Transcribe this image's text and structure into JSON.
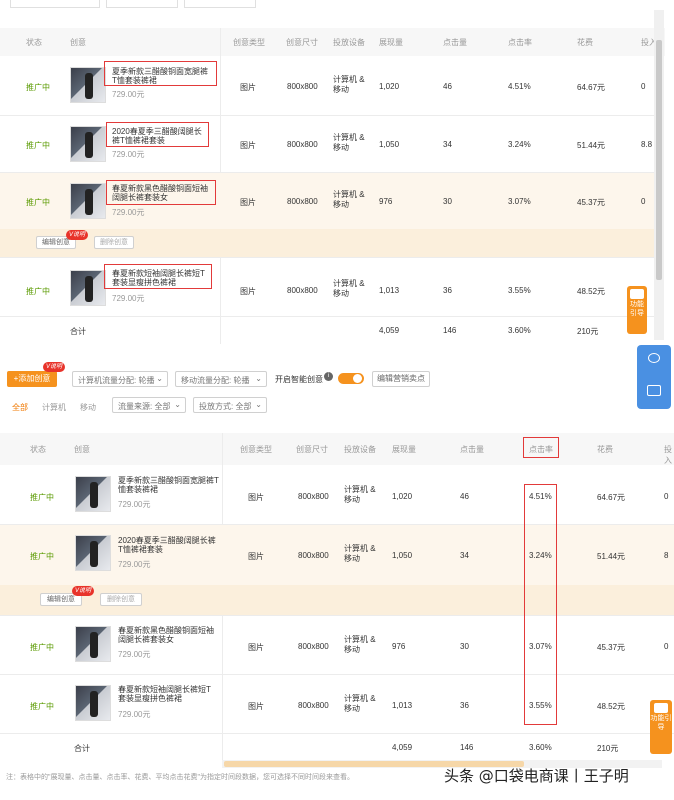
{
  "table_headers": {
    "status": "状态",
    "creative": "创意",
    "type": "创意类型",
    "size": "创意尺寸",
    "device": "投放设备",
    "impressions": "展现量",
    "clicks": "点击量",
    "ctr": "点击率",
    "cost": "花费",
    "extra": "投入"
  },
  "top_rows": [
    {
      "status": "推广中",
      "title": "夏季新款三醋酸铜面宽腿裤T恤套装裤裙",
      "price": "729.00元",
      "type": "图片",
      "size": "800x800",
      "device": "计算机 & 移动",
      "impressions": "1,020",
      "clicks": "46",
      "ctr": "4.51%",
      "cost": "64.67元",
      "extra": "0"
    },
    {
      "status": "推广中",
      "title": "2020春夏季三醋酸阔腿长裤T恤裤裙套装",
      "price": "729.00元",
      "type": "图片",
      "size": "800x800",
      "device": "计算机 & 移动",
      "impressions": "1,050",
      "clicks": "34",
      "ctr": "3.24%",
      "cost": "51.44元",
      "extra": "8.8"
    },
    {
      "status": "推广中",
      "title": "春夏新款黑色醋酸铜面短袖阔腿长裤套装女",
      "price": "729.00元",
      "type": "图片",
      "size": "800x800",
      "device": "计算机 & 移动",
      "impressions": "976",
      "clicks": "30",
      "ctr": "3.07%",
      "cost": "45.37元",
      "extra": "0"
    },
    {
      "status": "推广中",
      "title": "春夏新款短袖阔腿长裤短T套装显瘦拼色裤裙",
      "price": "729.00元",
      "type": "图片",
      "size": "800x800",
      "device": "计算机 & 移动",
      "impressions": "1,013",
      "clicks": "36",
      "ctr": "3.55%",
      "cost": "48.52元",
      "extra": "0"
    }
  ],
  "top_total": {
    "label": "合计",
    "impressions": "4,059",
    "clicks": "146",
    "ctr": "3.60%",
    "cost": "210元"
  },
  "row_actions": {
    "edit": "编辑创意",
    "delete": "删除创意",
    "badge": "V说明"
  },
  "toolbar": {
    "add_button": "+添加创意",
    "add_badge": "V说明",
    "pc_traffic": "计算机流量分配: 轮播",
    "mobile_traffic": "移动流量分配: 轮播",
    "smart_label": "开启智能创意",
    "edit_selling": "编辑营销卖点"
  },
  "filters": {
    "tab_all": "全部",
    "tab_pc": "计算机",
    "tab_mobile": "移动",
    "source": "流量来源: 全部",
    "delivery": "投放方式: 全部"
  },
  "bottom_rows": [
    {
      "status": "推广中",
      "title": "夏季新款三醋酸铜面宽腿裤T恤套装裤裙",
      "price": "729.00元",
      "type": "图片",
      "size": "800x800",
      "device": "计算机 & 移动",
      "impressions": "1,020",
      "clicks": "46",
      "ctr": "4.51%",
      "cost": "64.67元",
      "extra": "0"
    },
    {
      "status": "推广中",
      "title": "2020春夏季三醋酸阔腿长裤T恤裤裙套装",
      "price": "729.00元",
      "type": "图片",
      "size": "800x800",
      "device": "计算机 & 移动",
      "impressions": "1,050",
      "clicks": "34",
      "ctr": "3.24%",
      "cost": "51.44元",
      "extra": "8"
    },
    {
      "status": "推广中",
      "title": "春夏新款黑色醋酸铜面短袖阔腿长裤套装女",
      "price": "729.00元",
      "type": "图片",
      "size": "800x800",
      "device": "计算机 & 移动",
      "impressions": "976",
      "clicks": "30",
      "ctr": "3.07%",
      "cost": "45.37元",
      "extra": "0"
    },
    {
      "status": "推广中",
      "title": "春夏新款短袖阔腿长裤短T套装显瘦拼色裤裙",
      "price": "729.00元",
      "type": "图片",
      "size": "800x800",
      "device": "计算机 & 移动",
      "impressions": "1,013",
      "clicks": "36",
      "ctr": "3.55%",
      "cost": "48.52元",
      "extra": "0"
    }
  ],
  "bottom_total": {
    "label": "合计",
    "impressions": "4,059",
    "clicks": "146",
    "ctr": "3.60%",
    "cost": "210元"
  },
  "side_tab": "功能引导",
  "footnote": "注：表格中的\"展现量、点击量、点击率、花费、平均点击花费\"为指定时间段数据，您可选择不同时间段来查看。",
  "watermark": "头条 @口袋电商课丨王子明",
  "colors": {
    "accent": "#f5921e",
    "status_green": "#5a9a00",
    "highlight": "#e23a3a",
    "row_highlight": "#fdf6ec"
  }
}
